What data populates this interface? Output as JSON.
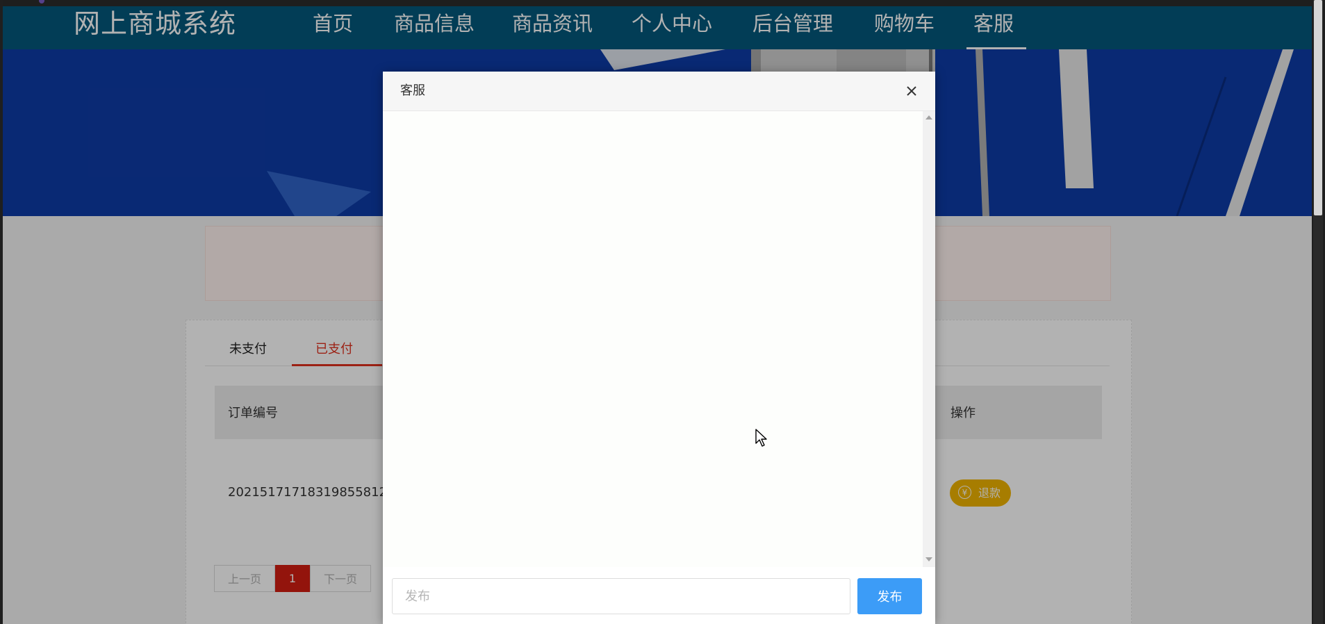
{
  "header": {
    "site_title": "网上商城系统",
    "nav": [
      "首页",
      "商品信息",
      "商品资讯",
      "个人中心",
      "后台管理",
      "购物车",
      "客服"
    ],
    "active_nav": "客服"
  },
  "orders": {
    "tabs": [
      "未支付",
      "已支付"
    ],
    "active_tab": "已支付",
    "columns": {
      "order_no": "订单编号",
      "action": "操作"
    },
    "rows": [
      {
        "order_no": "20215171718319855812",
        "action": "退款"
      }
    ]
  },
  "pagination": {
    "prev": "上一页",
    "current": "1",
    "next": "下一页"
  },
  "dialog": {
    "title": "客服",
    "input_placeholder": "发布",
    "send_label": "发布"
  },
  "colors": {
    "navbar": "#03587c",
    "accent_red": "#e0301e",
    "refund_button": "#f0b400",
    "send_button": "#3c9cf7"
  }
}
